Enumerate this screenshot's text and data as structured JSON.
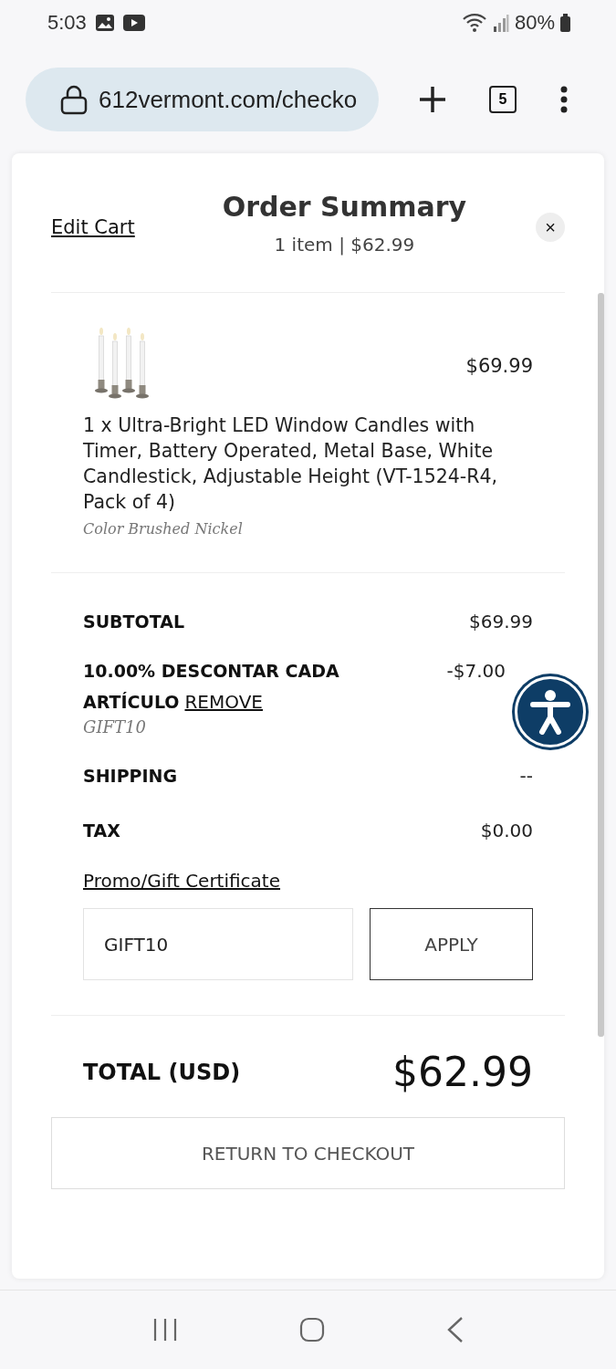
{
  "status_bar": {
    "time": "5:03",
    "battery": "80%"
  },
  "browser": {
    "url": "612vermont.com/checko",
    "tab_count": "5"
  },
  "header": {
    "edit_cart": "Edit Cart",
    "title": "Order Summary",
    "subtitle": "1 item | $62.99",
    "close": "×"
  },
  "item": {
    "price": "$69.99",
    "name": "1 x Ultra-Bright LED Window Candles with Timer, Battery Operated, Metal Base, White Candlestick, Adjustable Height (VT-1524-R4, Pack of 4)",
    "option": "Color Brushed Nickel"
  },
  "summary": [
    {
      "kind": "line",
      "label": "SUBTOTAL",
      "value": "$69.99"
    },
    {
      "kind": "discount",
      "label": "10.00% DESCONTAR CADA ARTÍCULO",
      "action": "REMOVE",
      "code": "GIFT10",
      "value": "-$7.00"
    },
    {
      "kind": "line",
      "label": "SHIPPING",
      "value": "--"
    },
    {
      "kind": "line",
      "label": "TAX",
      "value": "$0.00"
    }
  ],
  "promo": {
    "link": "Promo/Gift Certificate",
    "value": "GIFT10",
    "button": "APPLY"
  },
  "total": {
    "label": "TOTAL (USD)",
    "value": "$62.99"
  },
  "return_button": "RETURN TO CHECKOUT"
}
